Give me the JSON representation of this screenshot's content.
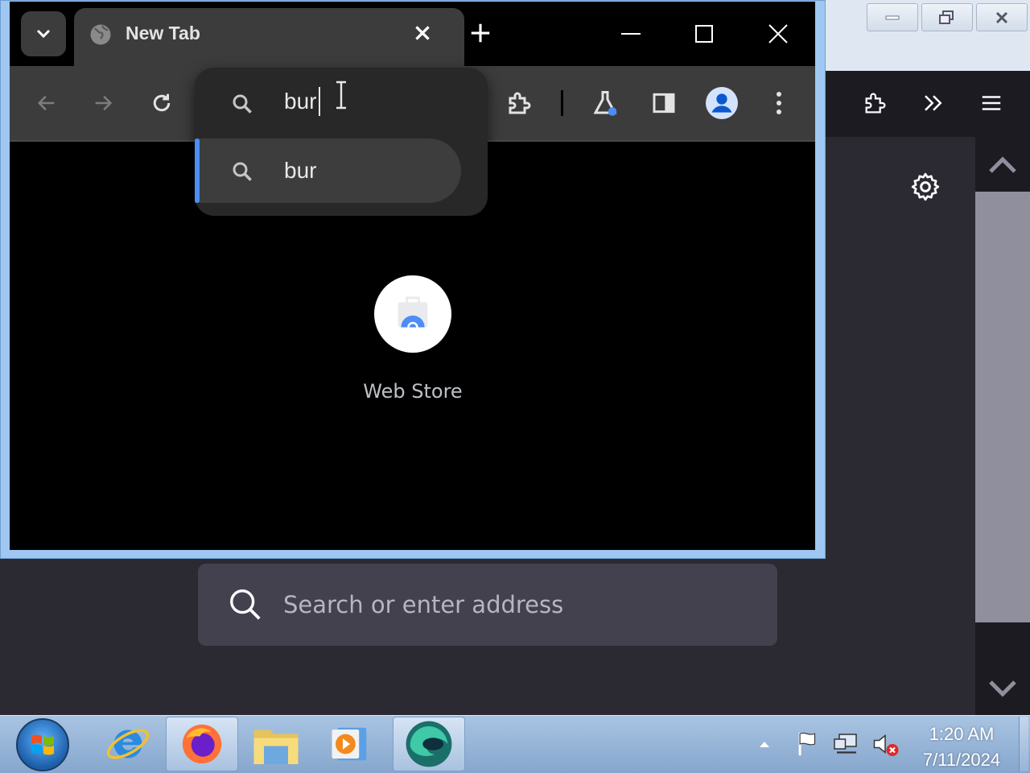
{
  "background_window": {
    "search": {
      "placeholder": "Search or enter address"
    },
    "icons": [
      "extension-icon",
      "overflow-chevrons-icon",
      "menu-icon",
      "settings-icon"
    ]
  },
  "chrome": {
    "tab": {
      "title": "New Tab"
    },
    "omnibox": {
      "value": "bur",
      "suggestions": [
        {
          "text": "bur"
        }
      ]
    },
    "shortcuts": [
      {
        "label": "Web Store"
      }
    ],
    "colors": {
      "accent": "#4c8df6",
      "titlebar": "#000000",
      "toolbar": "#3c3c3c"
    }
  },
  "taskbar": {
    "apps": [
      "internet-explorer",
      "firefox",
      "file-explorer",
      "media-player",
      "edge"
    ],
    "clock": {
      "time": "1:20 AM",
      "date": "7/11/2024"
    }
  }
}
